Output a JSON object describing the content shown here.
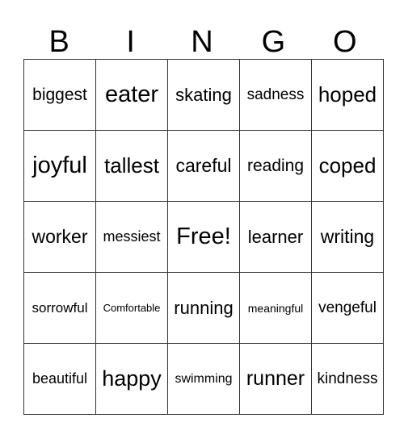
{
  "header": [
    "B",
    "I",
    "N",
    "G",
    "O"
  ],
  "rows": [
    [
      {
        "t": "biggest",
        "s": 21
      },
      {
        "t": "eater",
        "s": 29
      },
      {
        "t": "skating",
        "s": 22
      },
      {
        "t": "sadness",
        "s": 19
      },
      {
        "t": "hoped",
        "s": 26
      }
    ],
    [
      {
        "t": "joyful",
        "s": 29
      },
      {
        "t": "tallest",
        "s": 26
      },
      {
        "t": "careful",
        "s": 23
      },
      {
        "t": "reading",
        "s": 21
      },
      {
        "t": "coped",
        "s": 26
      }
    ],
    [
      {
        "t": "worker",
        "s": 23
      },
      {
        "t": "messiest",
        "s": 18
      },
      {
        "t": "Free!",
        "s": 29
      },
      {
        "t": "learner",
        "s": 22
      },
      {
        "t": "writing",
        "s": 23
      }
    ],
    [
      {
        "t": "sorrowful",
        "s": 17
      },
      {
        "t": "Comfortable",
        "s": 13
      },
      {
        "t": "running",
        "s": 22
      },
      {
        "t": "meaningful",
        "s": 14
      },
      {
        "t": "vengeful",
        "s": 19
      }
    ],
    [
      {
        "t": "beautiful",
        "s": 18
      },
      {
        "t": "happy",
        "s": 27
      },
      {
        "t": "swimming",
        "s": 16
      },
      {
        "t": "runner",
        "s": 25
      },
      {
        "t": "kindness",
        "s": 19
      }
    ]
  ]
}
